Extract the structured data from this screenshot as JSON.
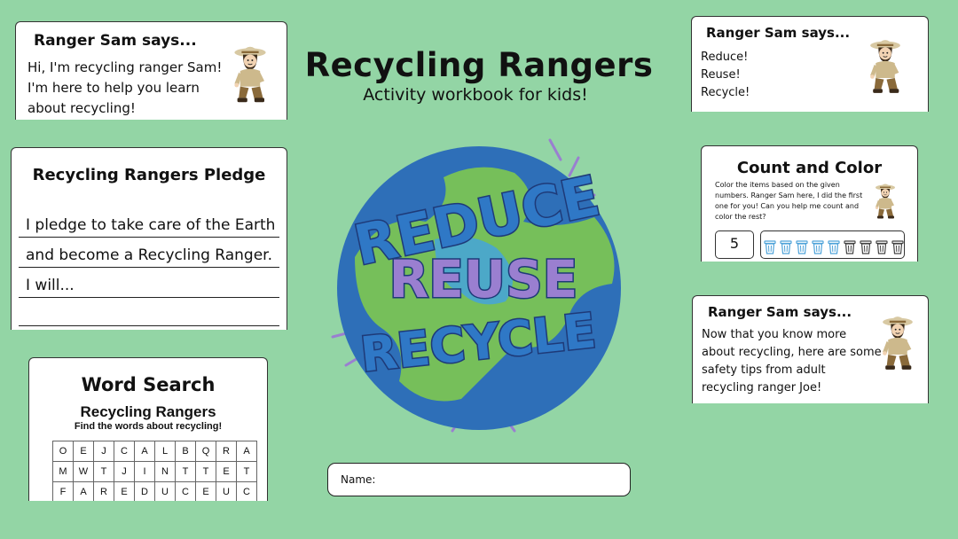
{
  "header": {
    "title": "Recycling Rangers",
    "subtitle": "Activity workbook for kids!"
  },
  "card_sam_intro": {
    "heading": "Ranger Sam says...",
    "lines": [
      "Hi, I'm recycling ranger Sam!",
      "I'm here to help you learn",
      "about recycling!"
    ]
  },
  "card_pledge": {
    "heading": "Recycling Rangers Pledge",
    "lines": [
      "I pledge to take care of the Earth",
      "and become a Recycling Ranger.",
      "I will...",
      ""
    ]
  },
  "card_wordsearch": {
    "heading": "Word Search",
    "title": "Recycling Rangers",
    "instruction": "Find the words about recycling!",
    "grid": [
      [
        "O",
        "E",
        "J",
        "C",
        "A",
        "L",
        "B",
        "Q",
        "R",
        "A"
      ],
      [
        "M",
        "W",
        "T",
        "J",
        "I",
        "N",
        "T",
        "T",
        "E",
        "T"
      ],
      [
        "F",
        "A",
        "R",
        "E",
        "D",
        "U",
        "C",
        "E",
        "U",
        "C"
      ]
    ]
  },
  "emblem": {
    "words": [
      "REDUCE",
      "REUSE",
      "RECYCLE"
    ]
  },
  "name_field": {
    "label": "Name:"
  },
  "card_sam_rrr": {
    "heading": "Ranger Sam says...",
    "lines": [
      "Reduce!",
      "Reuse!",
      "Recycle!"
    ]
  },
  "card_count": {
    "heading": "Count and Color",
    "text": [
      "Color the items based on the given",
      "numbers. Ranger Sam here, I did the first",
      "one for you! Can you help me count and",
      "color the rest?"
    ],
    "number": "5",
    "bins_total": 9,
    "bins_colored": 5,
    "colors": {
      "bin_colored": "#4fa3d9",
      "bin_plain": "#444444"
    }
  },
  "card_sam_safety": {
    "heading": "Ranger Sam says...",
    "lines": [
      "Now that you know more",
      "about recycling, here are some",
      "safety tips from adult",
      "recycling ranger Joe!"
    ]
  },
  "colors": {
    "background": "#93d5a5",
    "card": "#ffffff",
    "earth_blue": "#2e6fb8",
    "earth_green": "#7ec850",
    "letter_purple": "#9a7fd0"
  }
}
